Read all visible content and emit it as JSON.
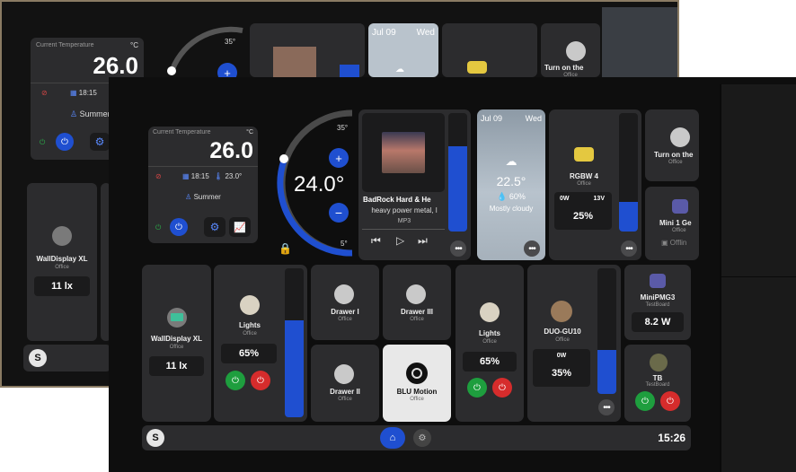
{
  "back": {
    "temp_label": "Current Temperature",
    "temp_unit": "°C",
    "temp_value": "26.0",
    "time_value": "18:15",
    "mode": "Summer",
    "setpoint_max": "35°",
    "weather_date": "Jul 09",
    "weather_day": "Wed",
    "device_turn_on": "Turn on the",
    "device_office": "Office",
    "wall_name": "WallDisplay XL",
    "wall_room": "Office",
    "wall_value": "11 lx"
  },
  "thermostat": {
    "label": "Current Temperature",
    "unit": "°C",
    "current": "26.0",
    "time": "18:15",
    "setpoint_small": "23.0°",
    "mode": "Summer",
    "setpoint": "24.0°",
    "max": "35°",
    "min": "5°"
  },
  "media": {
    "title": "BadRock Hard & He",
    "subtitle": "heavy power metal, l",
    "format": "MP3",
    "volume": 0.72
  },
  "weather": {
    "date": "Jul 09",
    "day": "Wed",
    "temp": "22.5°",
    "humidity": "60%",
    "condition": "Mostly cloudy"
  },
  "rgbw": {
    "name": "RGBW 4",
    "room": "Office",
    "power": "0W",
    "voltage": "13V",
    "level": "25%",
    "level_value": 0.25
  },
  "top_right": [
    {
      "name": "Turn on the",
      "room": "Office"
    },
    {
      "name": "Mini 1 Ge",
      "room": "Office",
      "status": "Offlin"
    }
  ],
  "wall_display": {
    "name": "WallDisplay XL",
    "room": "Office",
    "value": "11 lx"
  },
  "lights1": {
    "name": "Lights",
    "room": "Office",
    "level": "65%",
    "level_value": 0.65
  },
  "drawers": [
    {
      "name": "Drawer I",
      "room": "Office"
    },
    {
      "name": "Drawer III",
      "room": "Office"
    },
    {
      "name": "Drawer II",
      "room": "Office"
    }
  ],
  "blu_motion": {
    "name": "BLU Motion",
    "room": "Office"
  },
  "lights2": {
    "name": "Lights",
    "room": "Office",
    "level": "65%"
  },
  "duo": {
    "name": "DUO-GU10",
    "room": "Office",
    "power": "0W",
    "level": "35%",
    "level_value": 0.35
  },
  "mini_pm": {
    "name": "MiniPMG3",
    "room": "TestBoard",
    "value": "8.2 W"
  },
  "tb": {
    "name": "TB",
    "room": "TestBoard"
  },
  "clock": "15:26",
  "colors": {
    "accent": "#1f4fd0",
    "on": "#1e9e3e",
    "off": "#d62c2c",
    "tile": "#2c2c2e"
  }
}
